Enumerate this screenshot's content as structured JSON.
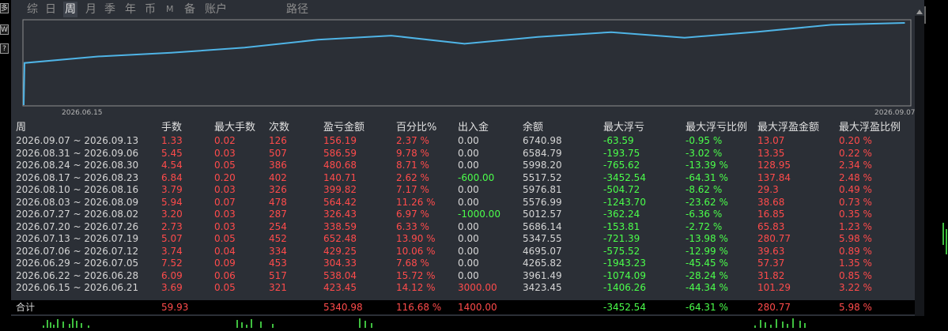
{
  "sidebar": {
    "buttons": [
      "多",
      "W",
      "?"
    ]
  },
  "tabs": [
    {
      "label": "综",
      "active": false
    },
    {
      "label": "日",
      "active": false
    },
    {
      "label": "周",
      "active": true
    },
    {
      "label": "月",
      "active": false
    },
    {
      "label": "季",
      "active": false
    },
    {
      "label": "年",
      "active": false
    },
    {
      "label": "币",
      "active": false
    },
    {
      "label": "M",
      "active": false
    },
    {
      "label": "备",
      "active": false
    },
    {
      "label": "账户",
      "active": false
    },
    {
      "label": "路径",
      "active": false
    }
  ],
  "chart_data": {
    "type": "line",
    "x_start_label": "2026.06.15",
    "x_end_label": "2026.09.07",
    "line_color": "#4fb4e6",
    "series": [
      {
        "values": [
          3423.45,
          3961.49,
          4265.82,
          4695.07,
          5347.55,
          5686.14,
          5012.57,
          5576.99,
          5976.81,
          5517.52,
          5998.2,
          6584.79,
          6740.98
        ]
      }
    ]
  },
  "table": {
    "headers": [
      "周",
      "手数",
      "最大手数",
      "次数",
      "盈亏金额",
      "百分比%",
      "出入金",
      "余额",
      "最大浮亏",
      "最大浮亏比例",
      "最大浮盈金额",
      "最大浮盈比例"
    ],
    "rows": [
      [
        "2026.09.07 ~ 2026.09.13",
        "1.33",
        "0.02",
        "126",
        "156.19",
        "2.37 %",
        "0.00",
        "6740.98",
        "-63.59",
        "-0.95 %",
        "13.07",
        "0.20 %"
      ],
      [
        "2026.08.31 ~ 2026.09.06",
        "5.45",
        "0.03",
        "507",
        "586.59",
        "9.78 %",
        "0.00",
        "6584.79",
        "-193.75",
        "-3.02 %",
        "13.35",
        "0.22 %"
      ],
      [
        "2026.08.24 ~ 2026.08.30",
        "4.54",
        "0.05",
        "386",
        "480.68",
        "8.71 %",
        "0.00",
        "5998.20",
        "-765.62",
        "-13.39 %",
        "128.95",
        "2.34 %"
      ],
      [
        "2026.08.17 ~ 2026.08.23",
        "6.84",
        "0.20",
        "402",
        "140.71",
        "2.62 %",
        "-600.00",
        "5517.52",
        "-3452.54",
        "-64.31 %",
        "137.84",
        "2.48 %"
      ],
      [
        "2026.08.10 ~ 2026.08.16",
        "3.79",
        "0.03",
        "326",
        "399.82",
        "7.17 %",
        "0.00",
        "5976.81",
        "-504.72",
        "-8.62 %",
        "29.3",
        "0.49 %"
      ],
      [
        "2026.08.03 ~ 2026.08.09",
        "5.94",
        "0.07",
        "478",
        "564.42",
        "11.26 %",
        "0.00",
        "5576.99",
        "-1243.70",
        "-23.62 %",
        "38.68",
        "0.73 %"
      ],
      [
        "2026.07.27 ~ 2026.08.02",
        "3.20",
        "0.03",
        "287",
        "326.43",
        "6.97 %",
        "-1000.00",
        "5012.57",
        "-362.24",
        "-6.36 %",
        "16.85",
        "0.35 %"
      ],
      [
        "2026.07.20 ~ 2026.07.26",
        "2.73",
        "0.03",
        "254",
        "338.59",
        "6.33 %",
        "0.00",
        "5686.14",
        "-153.81",
        "-2.72 %",
        "65.83",
        "1.23 %"
      ],
      [
        "2026.07.13 ~ 2026.07.19",
        "5.07",
        "0.05",
        "452",
        "652.48",
        "13.90 %",
        "0.00",
        "5347.55",
        "-721.39",
        "-13.98 %",
        "280.77",
        "5.98 %"
      ],
      [
        "2026.07.06 ~ 2026.07.12",
        "3.74",
        "0.04",
        "334",
        "429.25",
        "10.06 %",
        "0.00",
        "4695.07",
        "-575.52",
        "-12.99 %",
        "39.63",
        "0.89 %"
      ],
      [
        "2026.06.29 ~ 2026.07.05",
        "7.52",
        "0.09",
        "453",
        "304.33",
        "7.68 %",
        "0.00",
        "4265.82",
        "-1943.23",
        "-45.45 %",
        "57.37",
        "1.35 %"
      ],
      [
        "2026.06.22 ~ 2026.06.28",
        "6.09",
        "0.06",
        "517",
        "538.04",
        "15.72 %",
        "0.00",
        "3961.49",
        "-1074.09",
        "-28.24 %",
        "31.82",
        "0.85 %"
      ],
      [
        "2026.06.15 ~ 2026.06.21",
        "3.69",
        "0.05",
        "321",
        "423.45",
        "14.12 %",
        "3000.00",
        "3423.45",
        "-1406.26",
        "-44.34 %",
        "101.29",
        "3.22 %"
      ]
    ],
    "total": [
      "合计",
      "59.93",
      "",
      "",
      "5340.98",
      "116.68 %",
      "1400.00",
      "",
      "-3452.54",
      "-64.31 %",
      "280.77",
      "5.98 %"
    ]
  },
  "colors": {
    "positive": "#ff4b4b",
    "negative": "#4bff4b",
    "neutral": "#d6d6d6",
    "panel_bg": "#2b2f36"
  }
}
